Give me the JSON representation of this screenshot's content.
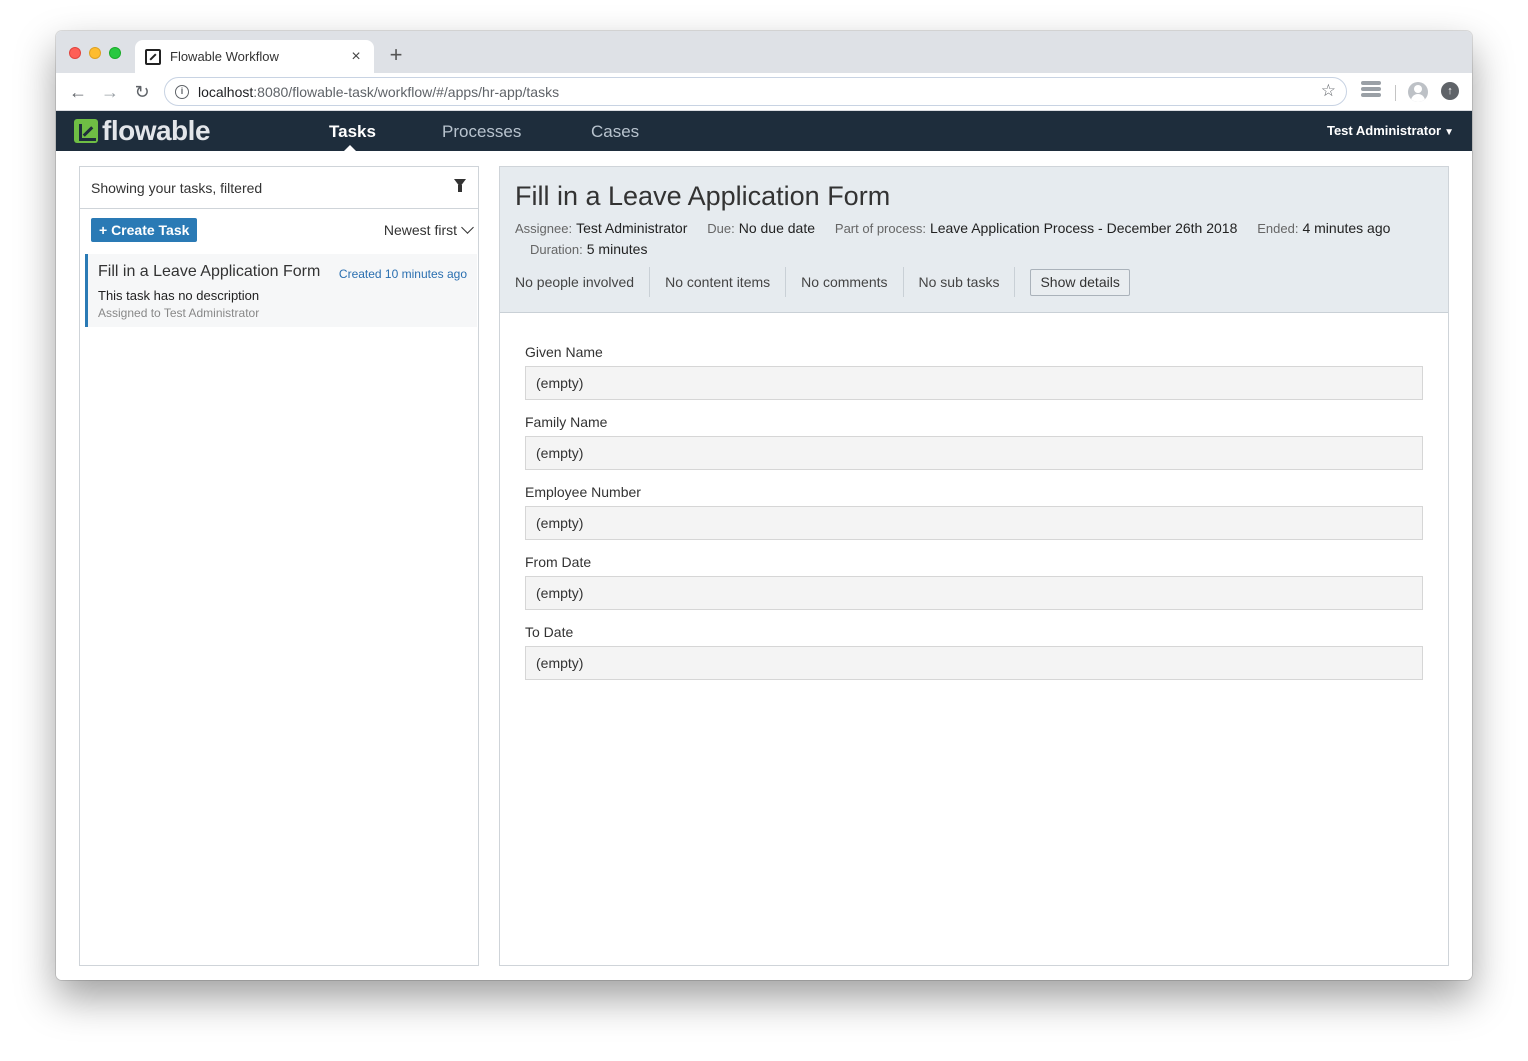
{
  "browser": {
    "tab_title": "Flowable Workflow",
    "tab_close": "×",
    "new_tab": "+",
    "url_host": "localhost",
    "url_rest": ":8080/flowable-task/workflow/#/apps/hr-app/tasks",
    "back": "←",
    "forward": "→",
    "reload": "↻",
    "star": "☆"
  },
  "app": {
    "logo_text": "flowable",
    "nav": [
      {
        "label": "Tasks",
        "active": true
      },
      {
        "label": "Processes",
        "active": false
      },
      {
        "label": "Cases",
        "active": false
      }
    ],
    "user": "Test Administrator",
    "brand_color": "#6fbe44",
    "nav_bg": "#1e2d3c"
  },
  "task_list": {
    "filter_text": "Showing your tasks, filtered",
    "create_label": "+ Create Task",
    "sort_label": "Newest first",
    "tasks": [
      {
        "title": "Fill in a Leave Application Form",
        "created": "Created 10 minutes ago",
        "description": "This task has no description",
        "assigned": "Assigned to Test Administrator"
      }
    ]
  },
  "detail": {
    "title": "Fill in a Leave Application Form",
    "assignee_label": "Assignee:",
    "assignee": "Test Administrator",
    "due_label": "Due:",
    "due": "No due date",
    "process_label": "Part of process:",
    "process": "Leave Application Process - December 26th 2018",
    "ended_label": "Ended:",
    "ended": "4 minutes ago",
    "duration_label": "Duration:",
    "duration": "5 minutes",
    "counters": [
      "No people involved",
      "No content items",
      "No comments",
      "No sub tasks"
    ],
    "show_details": "Show details",
    "fields": [
      {
        "label": "Given Name",
        "value": "(empty)"
      },
      {
        "label": "Family Name",
        "value": "(empty)"
      },
      {
        "label": "Employee Number",
        "value": "(empty)"
      },
      {
        "label": "From Date",
        "value": "(empty)"
      },
      {
        "label": "To Date",
        "value": "(empty)"
      }
    ]
  }
}
